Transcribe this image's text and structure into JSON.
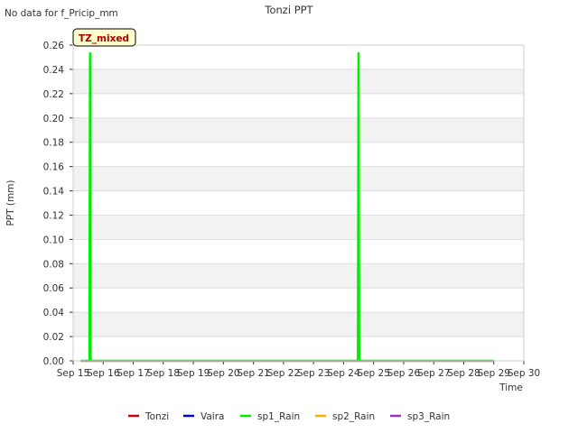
{
  "no_data_note": "No data for f_Pricip_mm",
  "chart_data": {
    "type": "line",
    "title": "Tonzi PPT",
    "xlabel": "Time",
    "ylabel": "PPT (mm)",
    "annotation": "TZ_mixed",
    "ylim": [
      0,
      0.26
    ],
    "xlim": [
      "2023-09-15",
      "2023-09-30"
    ],
    "yticks": [
      0.0,
      0.02,
      0.04,
      0.06,
      0.08,
      0.1,
      0.12,
      0.14,
      0.16,
      0.18,
      0.2,
      0.22,
      0.24,
      0.26
    ],
    "ytick_labels": [
      "0.00",
      "0.02",
      "0.04",
      "0.06",
      "0.08",
      "0.10",
      "0.12",
      "0.14",
      "0.16",
      "0.18",
      "0.20",
      "0.22",
      "0.24",
      "0.26"
    ],
    "xticks": [
      "2023-09-15",
      "2023-09-16",
      "2023-09-17",
      "2023-09-18",
      "2023-09-19",
      "2023-09-20",
      "2023-09-21",
      "2023-09-22",
      "2023-09-23",
      "2023-09-24",
      "2023-09-25",
      "2023-09-26",
      "2023-09-27",
      "2023-09-28",
      "2023-09-29",
      "2023-09-30"
    ],
    "xtick_labels": [
      "Sep 15",
      "Sep 16",
      "Sep 17",
      "Sep 18",
      "Sep 19",
      "Sep 20",
      "Sep 21",
      "Sep 22",
      "Sep 23",
      "Sep 24",
      "Sep 25",
      "Sep 26",
      "Sep 27",
      "Sep 28",
      "Sep 29",
      "Sep 30"
    ],
    "grid": true,
    "legend_position": "bottom",
    "series": [
      {
        "name": "Tonzi",
        "color": "#cc0000",
        "points": []
      },
      {
        "name": "Vaira",
        "color": "#0000bb",
        "points": []
      },
      {
        "name": "sp1_Rain",
        "color": "#00ee00",
        "points": [
          [
            "2023-09-15T06:00",
            0.0
          ],
          [
            "2023-09-15T13:00",
            0.0
          ],
          [
            "2023-09-15T13:30",
            0.254
          ],
          [
            "2023-09-15T14:00",
            0.0
          ],
          [
            "2023-09-24T11:30",
            0.0
          ],
          [
            "2023-09-24T12:00",
            0.254
          ],
          [
            "2023-09-24T12:30",
            0.0
          ],
          [
            "2023-09-29T00:00",
            0.0
          ]
        ]
      },
      {
        "name": "sp2_Rain",
        "color": "#ffaa00",
        "points": [
          [
            "2023-09-15T06:00",
            0.0
          ],
          [
            "2023-09-29T00:00",
            0.0
          ]
        ]
      },
      {
        "name": "sp3_Rain",
        "color": "#9933cc",
        "points": [
          [
            "2023-09-15T06:00",
            0.0
          ],
          [
            "2023-09-29T00:00",
            0.0
          ]
        ]
      }
    ]
  }
}
